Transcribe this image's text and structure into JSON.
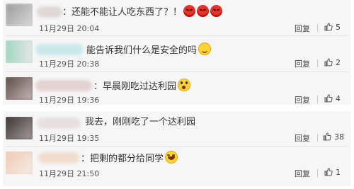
{
  "comments": [
    {
      "text": "：还能不能让人吃东西了？！",
      "emojis": [
        "angry",
        "angry",
        "angry"
      ],
      "time": "11月29日 20:04",
      "reply": "回复",
      "likes": "5"
    },
    {
      "text": "能告诉我们什么是安全的吗",
      "emojis": [
        "smile"
      ],
      "time": "11月29日 20:38",
      "reply": "回复",
      "likes": "2"
    },
    {
      "text": "：早晨刚吃过达利园",
      "emojis": [
        "shock"
      ],
      "time": "11月29日 19:36",
      "reply": "回复",
      "likes": "4"
    },
    {
      "text": "我去，刚刚吃了一个达利园",
      "emojis": [],
      "time": "11月29日 19:35",
      "reply": "回复",
      "likes": "38"
    },
    {
      "text": "：把剩的都分给同学",
      "emojis": [
        "laugh"
      ],
      "time": "11月29日 21:50",
      "reply": "回复",
      "likes": "1"
    }
  ],
  "icons": {
    "like": "thumbs-up-icon"
  },
  "colors": {
    "card": "#f6f6f6",
    "divider": "#e2e2e2"
  }
}
